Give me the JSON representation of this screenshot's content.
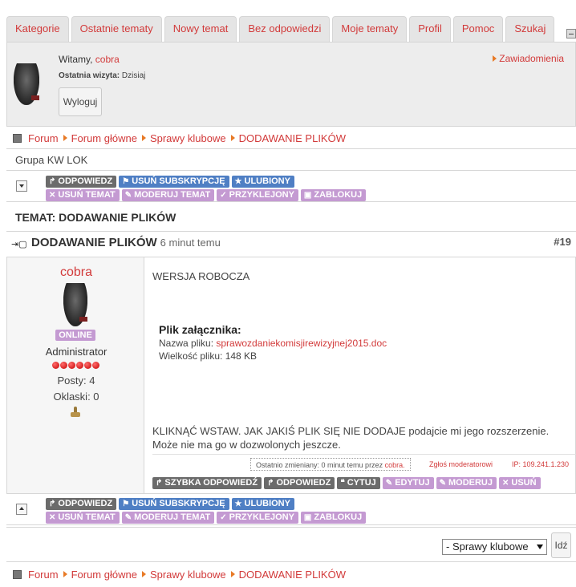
{
  "tabs": [
    "Kategorie",
    "Ostatnie tematy",
    "Nowy temat",
    "Bez odpowiedzi",
    "Moje tematy",
    "Profil",
    "Pomoc",
    "Szukaj"
  ],
  "user": {
    "welcome_prefix": "Witamy,",
    "username": "cobra",
    "last_visit_label": "Ostatnia wizyta:",
    "last_visit_value": "Dzisiaj",
    "logout_label": "Wyloguj",
    "notifications_label": "Zawiadomienia"
  },
  "breadcrumbs": [
    "Forum",
    "Forum główne",
    "Sprawy klubowe",
    "DODAWANIE PLIKÓW"
  ],
  "group": "Grupa KW LOK",
  "toolbar": {
    "row1": [
      {
        "label": "ODPOWIEDZ",
        "icon": "reply-icon",
        "color": "gray"
      },
      {
        "label": "USUŃ SUBSKRYPCJĘ",
        "icon": "flag-icon",
        "color": "blue"
      },
      {
        "label": "ULUBIONY",
        "icon": "star-icon",
        "color": "blue"
      }
    ],
    "row2": [
      {
        "label": "USUŃ TEMAT",
        "icon": "delete-icon",
        "color": "purple"
      },
      {
        "label": "MODERUJ TEMAT",
        "icon": "wrench-icon",
        "color": "purple"
      },
      {
        "label": "PRZYKLEJONY",
        "icon": "check-icon",
        "color": "purple"
      },
      {
        "label": "ZABLOKUJ",
        "icon": "lock-icon",
        "color": "purple"
      }
    ]
  },
  "topic": {
    "header": "TEMAT: DODAWANIE PLIKÓW",
    "post_title": "DODAWANIE PLIKÓW",
    "post_time": "6 minut temu",
    "post_number": "#19"
  },
  "post": {
    "author": "cobra",
    "status": "ONLINE",
    "role": "Administrator",
    "posts": "Posty: 4",
    "claps": "Oklaski: 0",
    "body_top": "WERSJA ROBOCZA",
    "attachment_heading": "Plik załącznika:",
    "file_name_label": "Nazwa pliku:",
    "file_name": "sprawozdaniekomisjirewizyjnej2015.doc",
    "file_size": "Wielkość pliku: 148 KB",
    "body_caps": "KLIKNĄĆ WSTAW. JAK JAKIŚ PLIK SIĘ NIE DODAJE",
    "body_rest": " podajcie mi jego rozszerzenie. Może nie ma go w dozwolonych jeszcze.",
    "edited_text": "Ostatnio zmieniany: 0 minut temu przez",
    "edited_by": "cobra.",
    "report": "Zgłoś moderatorowi",
    "ip": "IP: 109.241.1.230",
    "buttons": [
      {
        "label": "SZYBKA ODPOWIEDŹ",
        "icon": "reply-icon",
        "color": "gray"
      },
      {
        "label": "ODPOWIEDZ",
        "icon": "reply-icon",
        "color": "gray"
      },
      {
        "label": "CYTUJ",
        "icon": "quote-icon",
        "color": "gray"
      },
      {
        "label": "EDYTUJ",
        "icon": "edit-icon",
        "color": "purple"
      },
      {
        "label": "MODERUJ",
        "icon": "wrench-icon",
        "color": "purple"
      },
      {
        "label": "USUŃ",
        "icon": "delete-icon",
        "color": "purple"
      }
    ]
  },
  "jump": {
    "selected": "- Sprawy klubowe",
    "go_label": "Idź"
  },
  "colors": {
    "link": "#d23a3a",
    "gray_button": "#6b6b6b",
    "blue_button": "#4f7fc4",
    "purple_button": "#c49ad2",
    "arrow": "#e87a26"
  }
}
